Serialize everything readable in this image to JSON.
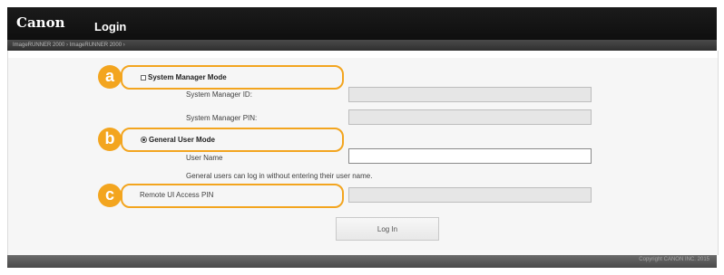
{
  "header": {
    "brand": "Canon",
    "title": "Login",
    "breadcrumb": "ImageRUNNER 2000 › ImageRUNNER 2000 ›"
  },
  "callouts": [
    "a",
    "b",
    "c"
  ],
  "system_manager": {
    "label": "System Manager Mode",
    "id_label": "System Manager ID:",
    "pin_label": "System Manager PIN:",
    "id_value": "",
    "pin_value": ""
  },
  "general_user": {
    "label": "General User Mode",
    "user_name_label": "User Name",
    "user_name_value": "",
    "note": "General users can log in without entering their user name."
  },
  "remote_ui": {
    "label": "Remote UI Access PIN",
    "pin_value": ""
  },
  "login_button": "Log In",
  "footer": {
    "copyright": "Copyright CANON INC. 2015"
  },
  "colors": {
    "header_bg": "#111111",
    "accent_orange": "#f3a51f"
  }
}
